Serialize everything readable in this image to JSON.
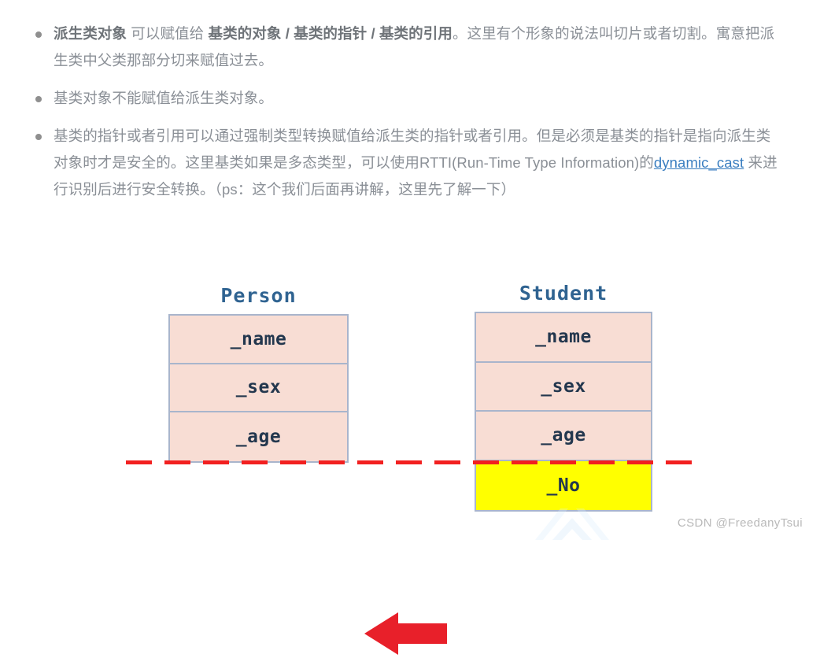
{
  "notes": {
    "bullets": [
      {
        "id": "bullet-assign-derived-to-base",
        "segments": [
          {
            "type": "strong",
            "text": "派生类对象"
          },
          {
            "type": "plain",
            "text": " 可以赋值给 "
          },
          {
            "type": "strong",
            "text": "基类的对象 / 基类的指针 / 基类的引用"
          },
          {
            "type": "plain",
            "text": "。这里有个形象的说法叫切片或者切割。寓意把派生类中父类那部分切来赋值过去。"
          }
        ]
      },
      {
        "id": "bullet-base-cannot-assign-derived",
        "segments": [
          {
            "type": "plain",
            "text": "基类对象不能赋值给派生类对象。"
          }
        ]
      },
      {
        "id": "bullet-pointer-reference-cast",
        "segments": [
          {
            "type": "plain",
            "text": "基类的指针或者引用可以通过强制类型转换赋值给派生类的指针或者引用。但是必须是基类的指针是指向派生类对象时才是安全的。这里基类如果是多态类型，可以使用RTTI(Run-Time Type Information)的"
          },
          {
            "type": "link",
            "text": "dynamic_cast"
          },
          {
            "type": "plain",
            "text": " 来进行识别后进行安全转换。（ps：这个我们后面再讲解，这里先了解一下）"
          }
        ]
      }
    ]
  },
  "diagram": {
    "person": {
      "title": "Person",
      "fields": [
        {
          "label": "_name",
          "highlight": false
        },
        {
          "label": "_sex",
          "highlight": false
        },
        {
          "label": "_age",
          "highlight": false
        }
      ]
    },
    "student": {
      "title": "Student",
      "fields": [
        {
          "label": "_name",
          "highlight": false
        },
        {
          "label": "_sex",
          "highlight": false
        },
        {
          "label": "_age",
          "highlight": false
        },
        {
          "label": "_No",
          "highlight": true
        }
      ]
    },
    "arrow_direction": "left",
    "colors": {
      "box_fill": "#F8DDD4",
      "box_border": "#A9B5CC",
      "highlight_fill": "#FFFF00",
      "title_text": "#2F6391",
      "field_text": "#23374E",
      "slice_line": "#F22020",
      "arrow": "#E8202A",
      "note_text": "#8A8F96",
      "link_text": "#3A7EC0"
    }
  },
  "watermark": {
    "credit": "CSDN @FreedanyTsui"
  }
}
